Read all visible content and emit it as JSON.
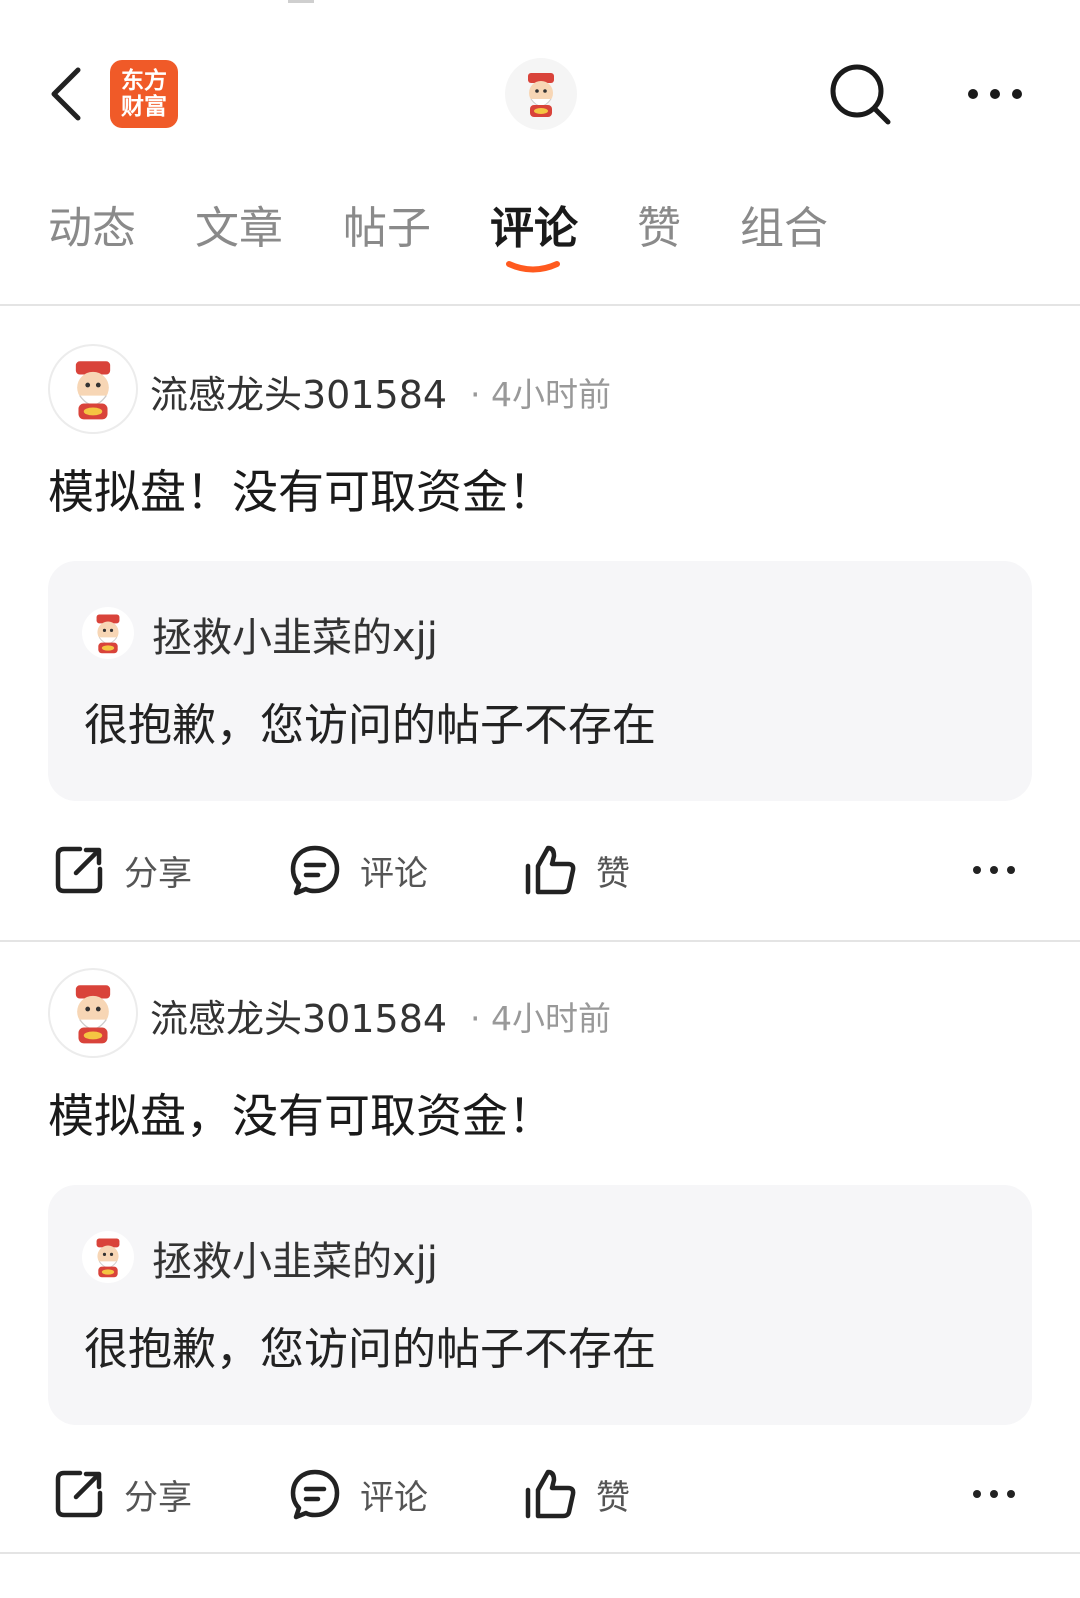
{
  "header": {
    "logo_line1": "东方",
    "logo_line2": "财富"
  },
  "tabs": [
    {
      "label": "动态",
      "active": false
    },
    {
      "label": "文章",
      "active": false
    },
    {
      "label": "帖子",
      "active": false
    },
    {
      "label": "评论",
      "active": true
    },
    {
      "label": "赞",
      "active": false
    },
    {
      "label": "组合",
      "active": false
    }
  ],
  "accent_color": "#ff5a1f",
  "posts": [
    {
      "author": "流感龙头301584",
      "time": "· 4小时前",
      "text": "模拟盘！没有可取资金！",
      "quote_author": "拯救小韭菜的xjj",
      "quote_text": "很抱歉，您访问的帖子不存在",
      "actions": {
        "share": "分享",
        "comment": "评论",
        "like": "赞"
      }
    },
    {
      "author": "流感龙头301584",
      "time": "· 4小时前",
      "text": "模拟盘，没有可取资金！",
      "quote_author": "拯救小韭菜的xjj",
      "quote_text": "很抱歉，您访问的帖子不存在",
      "actions": {
        "share": "分享",
        "comment": "评论",
        "like": "赞"
      }
    }
  ]
}
